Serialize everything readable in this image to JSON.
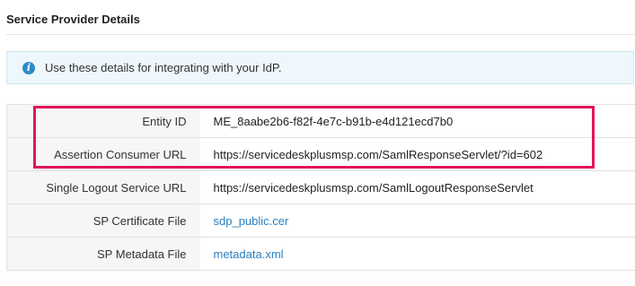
{
  "section": {
    "title": "Service Provider Details"
  },
  "info_banner": {
    "icon": "info-icon",
    "text": "Use these details for integrating with your IdP."
  },
  "details": [
    {
      "label": "Entity ID",
      "value": "ME_8aabe2b6-f82f-4e7c-b91b-e4d121ecd7b0",
      "is_link": false
    },
    {
      "label": "Assertion Consumer URL",
      "value": "https://servicedeskplusmsp.com/SamlResponseServlet/?id=602",
      "is_link": false
    },
    {
      "label": "Single Logout Service URL",
      "value": "https://servicedeskplusmsp.com/SamlLogoutResponseServlet",
      "is_link": false
    },
    {
      "label": "SP Certificate File",
      "value": "sdp_public.cer",
      "is_link": true
    },
    {
      "label": "SP Metadata File",
      "value": "metadata.xml",
      "is_link": true
    }
  ],
  "colors": {
    "highlight": "#e3155b",
    "link": "#2a7fc1",
    "banner_bg": "#eef7fb",
    "info_icon": "#2d8ac7"
  }
}
